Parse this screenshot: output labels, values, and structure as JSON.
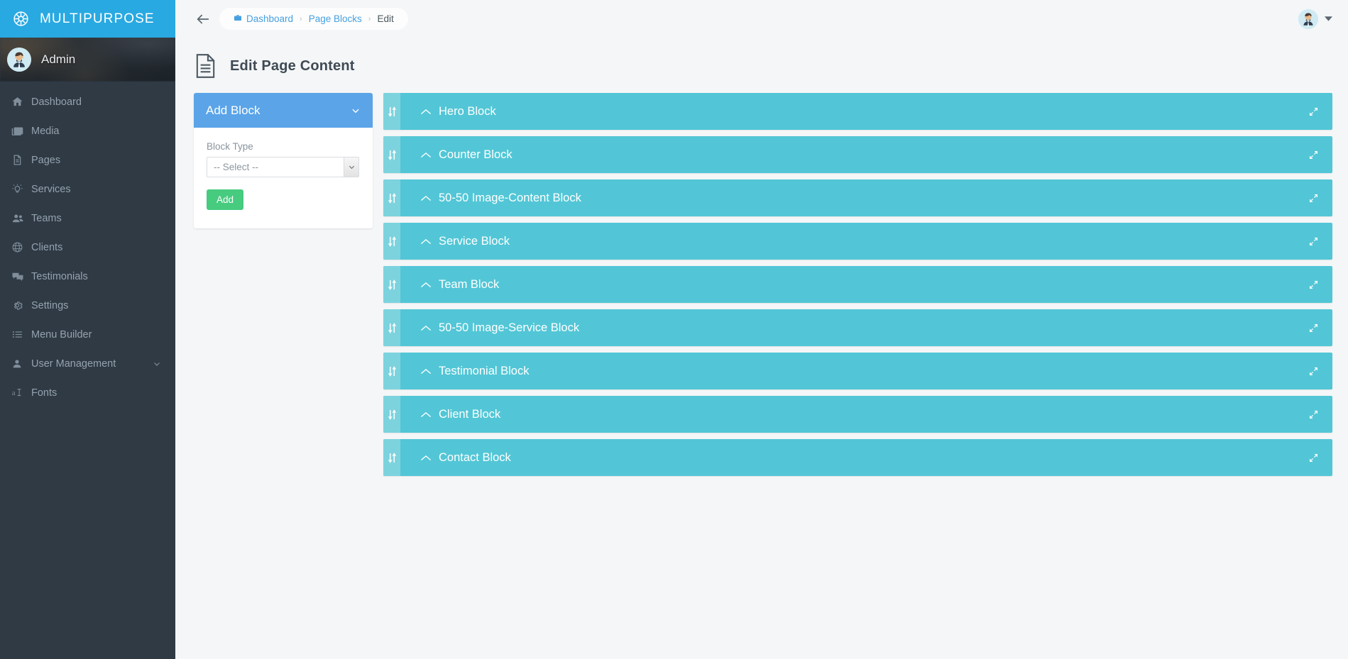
{
  "sidebar": {
    "brand": "MULTIPURPOSE",
    "brand_icon": "ship-wheel-icon",
    "user": "Admin",
    "items": [
      {
        "label": "Dashboard",
        "icon": "home-icon"
      },
      {
        "label": "Media",
        "icon": "image-icon"
      },
      {
        "label": "Pages",
        "icon": "file-text-icon"
      },
      {
        "label": "Services",
        "icon": "lightbulb-icon"
      },
      {
        "label": "Teams",
        "icon": "users-icon"
      },
      {
        "label": "Clients",
        "icon": "globe-icon"
      },
      {
        "label": "Testimonials",
        "icon": "comments-icon"
      },
      {
        "label": "Settings",
        "icon": "gear-icon"
      },
      {
        "label": "Menu Builder",
        "icon": "list-icon"
      },
      {
        "label": "User Management",
        "icon": "user-icon",
        "caret": "chevron-down-icon"
      },
      {
        "label": "Fonts",
        "icon": "font-icon"
      }
    ]
  },
  "topbar": {
    "back_icon": "arrow-left-icon",
    "breadcrumb": [
      {
        "label": "Dashboard",
        "icon": "briefcase-icon",
        "link": true
      },
      {
        "label": "Page Blocks",
        "link": true
      },
      {
        "label": "Edit",
        "link": false
      }
    ],
    "separator": "›",
    "avatar": "user-avatar",
    "caret": "caret-down-icon"
  },
  "page": {
    "title": "Edit Page Content",
    "title_icon": "document-icon"
  },
  "add_block_card": {
    "header": "Add Block",
    "header_caret": "chevron-down-icon",
    "field_label": "Block Type",
    "select_value": "-- Select --",
    "select_arrow": "chevron-down-icon",
    "add_button": "Add"
  },
  "blocks": {
    "handle_icon": "sort-updown-icon",
    "collapse_icon": "chevron-up-icon",
    "expand_icon": "expand-arrows-icon",
    "items": [
      {
        "label": "Hero Block"
      },
      {
        "label": "Counter Block"
      },
      {
        "label": "50-50 Image-Content Block"
      },
      {
        "label": "Service Block"
      },
      {
        "label": "Team Block"
      },
      {
        "label": "50-50 Image-Service Block"
      },
      {
        "label": "Testimonial Block"
      },
      {
        "label": "Client Block"
      },
      {
        "label": "Contact Block"
      }
    ]
  },
  "colors": {
    "brand_blue": "#29a9e1",
    "sidebar_bg": "#2f3a45",
    "card_header_blue": "#5ba4e8",
    "block_teal": "#52c6d6",
    "block_handle_teal": "#7cd3de",
    "add_green": "#46cb7f",
    "page_bg": "#f4f6f7"
  }
}
